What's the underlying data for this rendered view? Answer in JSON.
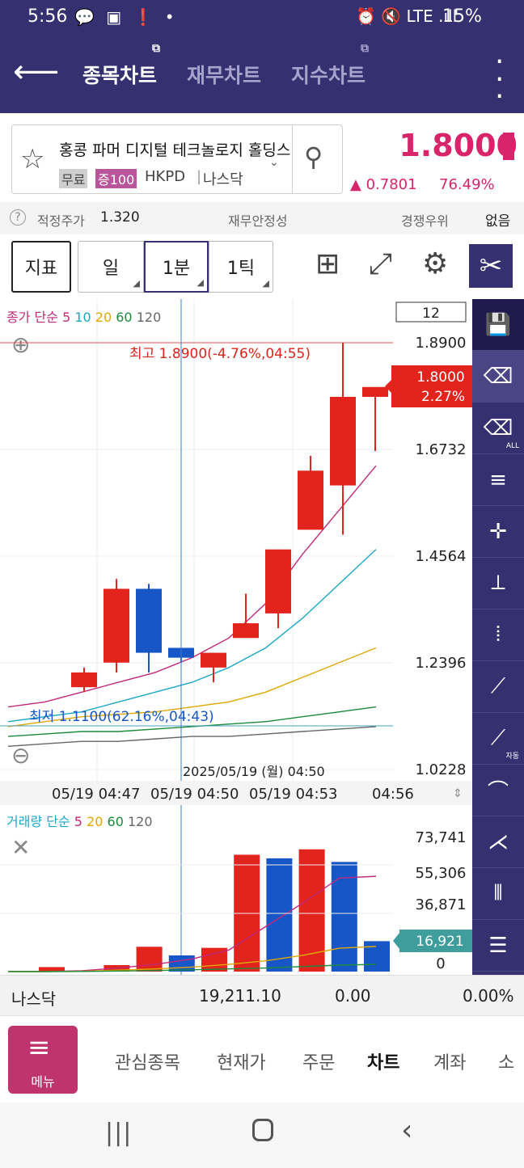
{
  "statusbar": {
    "time": "5:56",
    "left_icons": "💬 ▣ ❗ •",
    "right_icons": "⏰ 🔇 LTE .ıll",
    "battery": "15%"
  },
  "appbar": {
    "tabs": [
      {
        "label": "종목차트"
      },
      {
        "label": "재무차트"
      },
      {
        "label": "지수차트"
      }
    ]
  },
  "stock": {
    "name": "홍콩 파머 디지털 테크놀로지 홀딩스",
    "tag_free": "무료",
    "tag_margin": "증100",
    "ticker": "HKPD",
    "market": "나스닥",
    "price": "1.8000",
    "change": "▲ 0.7801",
    "change_pct": "76.49%"
  },
  "inforow": {
    "fair_label": "적정주가",
    "fair_value": "1.320",
    "fin_label": "재무안정성",
    "comp_label": "경쟁우위",
    "none_label": "없음"
  },
  "toolbar": {
    "indicator": "지표",
    "day": "일",
    "min1": "1분",
    "tick1": "1틱"
  },
  "chart_data": {
    "type": "candlestick",
    "price_legend": {
      "label": "종가 단순",
      "periods": [
        "5",
        "10",
        "20",
        "60",
        "120"
      ]
    },
    "volume_legend": {
      "label": "거래량 단순",
      "periods": [
        "5",
        "20",
        "60",
        "120"
      ]
    },
    "candle_count_label": "12",
    "high_label": "최고 1.8900(-4.76%,04:55)",
    "low_label": "최저 1.1100(62.16%,04:43)",
    "current_price_label": "1.8000",
    "current_pct_label": "2.27%",
    "price_ticks": [
      "1.8900",
      "1.6732",
      "1.4564",
      "1.2396",
      "1.0228"
    ],
    "ylim": [
      1.0228,
      1.89
    ],
    "crosshair_label": "2025/05/19 (월) 04:50",
    "x_ticks": [
      "05/19 04:47",
      "05/19 04:50",
      "05/19 04:53",
      "04:56"
    ],
    "candles": [
      {
        "o": 1.22,
        "h": 1.23,
        "l": 1.18,
        "c": 1.19,
        "up": true
      },
      {
        "o": 1.24,
        "h": 1.41,
        "l": 1.22,
        "c": 1.39,
        "up": true
      },
      {
        "o": 1.39,
        "h": 1.4,
        "l": 1.22,
        "c": 1.26,
        "up": false
      },
      {
        "o": 1.27,
        "h": 1.26,
        "l": 1.24,
        "c": 1.25,
        "up": false
      },
      {
        "o": 1.26,
        "h": 1.26,
        "l": 1.2,
        "c": 1.23,
        "up": true
      },
      {
        "o": 1.29,
        "h": 1.38,
        "l": 1.29,
        "c": 1.32,
        "up": true
      },
      {
        "o": 1.34,
        "h": 1.47,
        "l": 1.31,
        "c": 1.47,
        "up": true
      },
      {
        "o": 1.51,
        "h": 1.66,
        "l": 1.51,
        "c": 1.63,
        "up": true
      },
      {
        "o": 1.6,
        "h": 1.89,
        "l": 1.5,
        "c": 1.78,
        "up": true
      },
      {
        "o": 1.78,
        "h": 1.78,
        "l": 1.67,
        "c": 1.8,
        "up": true
      }
    ],
    "volume_ticks": [
      "73,741",
      "55,306",
      "36,871",
      "16,921",
      "0"
    ],
    "volume_max": 73741,
    "volumes": [
      {
        "v": 2500,
        "up": true
      },
      {
        "v": 0,
        "up": true
      },
      {
        "v": 3600,
        "up": true
      },
      {
        "v": 13800,
        "up": true
      },
      {
        "v": 9000,
        "up": false
      },
      {
        "v": 13200,
        "up": true
      },
      {
        "v": 65000,
        "up": true
      },
      {
        "v": 63000,
        "up": false
      },
      {
        "v": 68000,
        "up": true
      },
      {
        "v": 61000,
        "up": false
      },
      {
        "v": 16921,
        "up": false
      }
    ],
    "current_volume_label": "16,921"
  },
  "nasdaq": {
    "label": "나스닥",
    "value": "19,211.10",
    "change": "0.00",
    "pct": "0.00%"
  },
  "bottomnav": {
    "menu": "메뉴",
    "items": [
      {
        "label": "관심종목"
      },
      {
        "label": "현재가"
      },
      {
        "label": "주문"
      },
      {
        "label": "차트"
      },
      {
        "label": "계좌"
      },
      {
        "label": "소"
      }
    ]
  },
  "colors": {
    "brand": "#35306f",
    "up": "#e3241c",
    "down": "#1756c7",
    "accent": "#d8246a"
  }
}
